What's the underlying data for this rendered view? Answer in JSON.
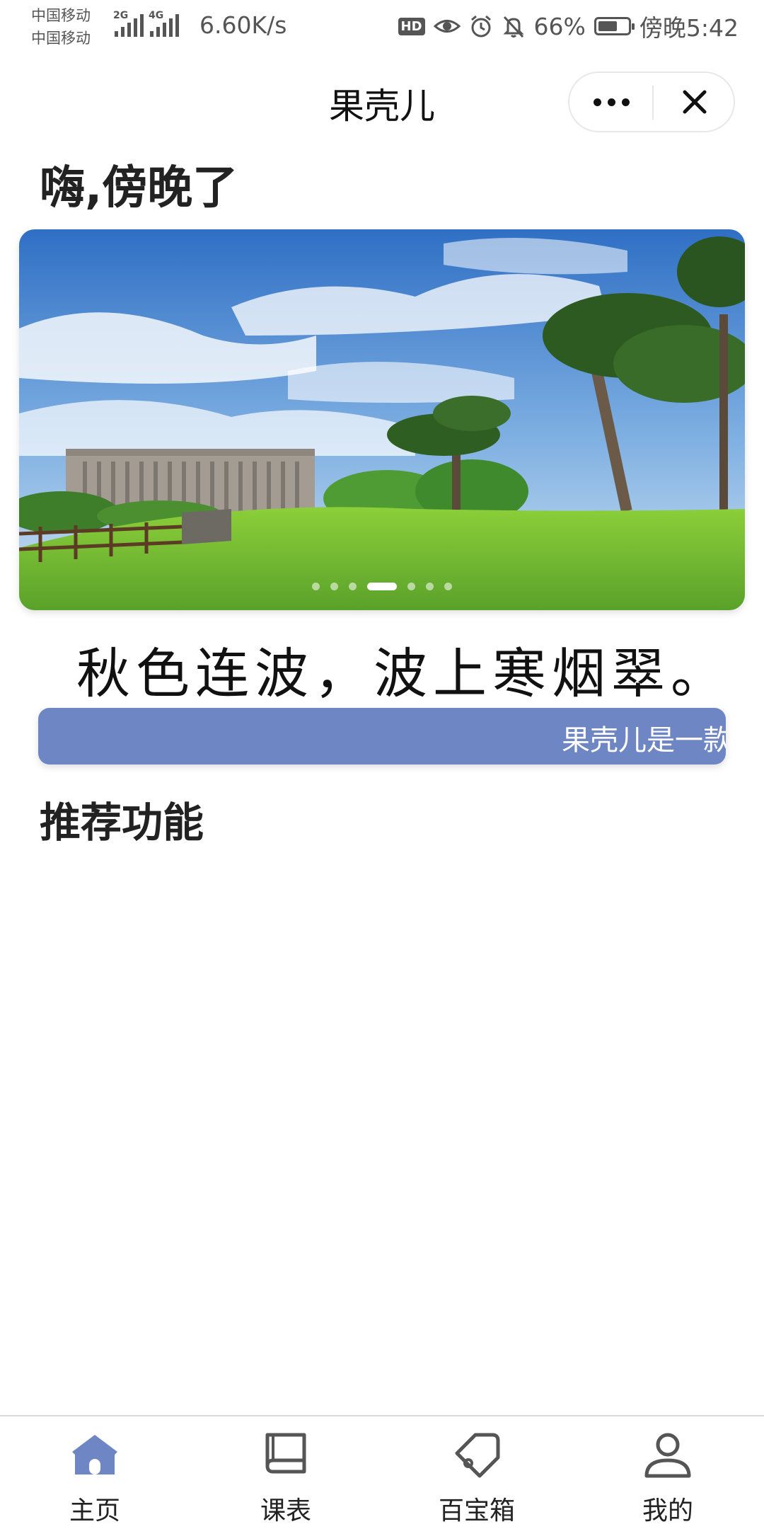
{
  "status_bar": {
    "carrier_1": "中国移动",
    "carrier_2": "中国移动",
    "network_1": "2G",
    "network_2": "4G",
    "speed": "6.60K/s",
    "hd": "HD",
    "battery_percent": "66%",
    "battery_level": 0.66,
    "time": "傍晚5:42",
    "icons": [
      "eye-icon",
      "alarm-icon",
      "mute-bell-icon"
    ]
  },
  "nav": {
    "title": "果壳儿",
    "more_icon": "more-dots-icon",
    "close_icon": "close-icon"
  },
  "greeting": "嗨,傍晚了",
  "banner": {
    "slide_count": 7,
    "active_slide": 4
  },
  "poem": "秋色连波，波上寒烟翠。",
  "marquee": {
    "text": "果壳儿是一款"
  },
  "section_title": "推荐功能",
  "tabbar": {
    "active_color": "#6f86c4",
    "inactive_color": "#555555",
    "items": [
      {
        "label": "主页",
        "icon": "home-icon",
        "active": true
      },
      {
        "label": "课表",
        "icon": "book-icon",
        "active": false
      },
      {
        "label": "百宝箱",
        "icon": "tag-icon",
        "active": false
      },
      {
        "label": "我的",
        "icon": "user-icon",
        "active": false
      }
    ]
  }
}
